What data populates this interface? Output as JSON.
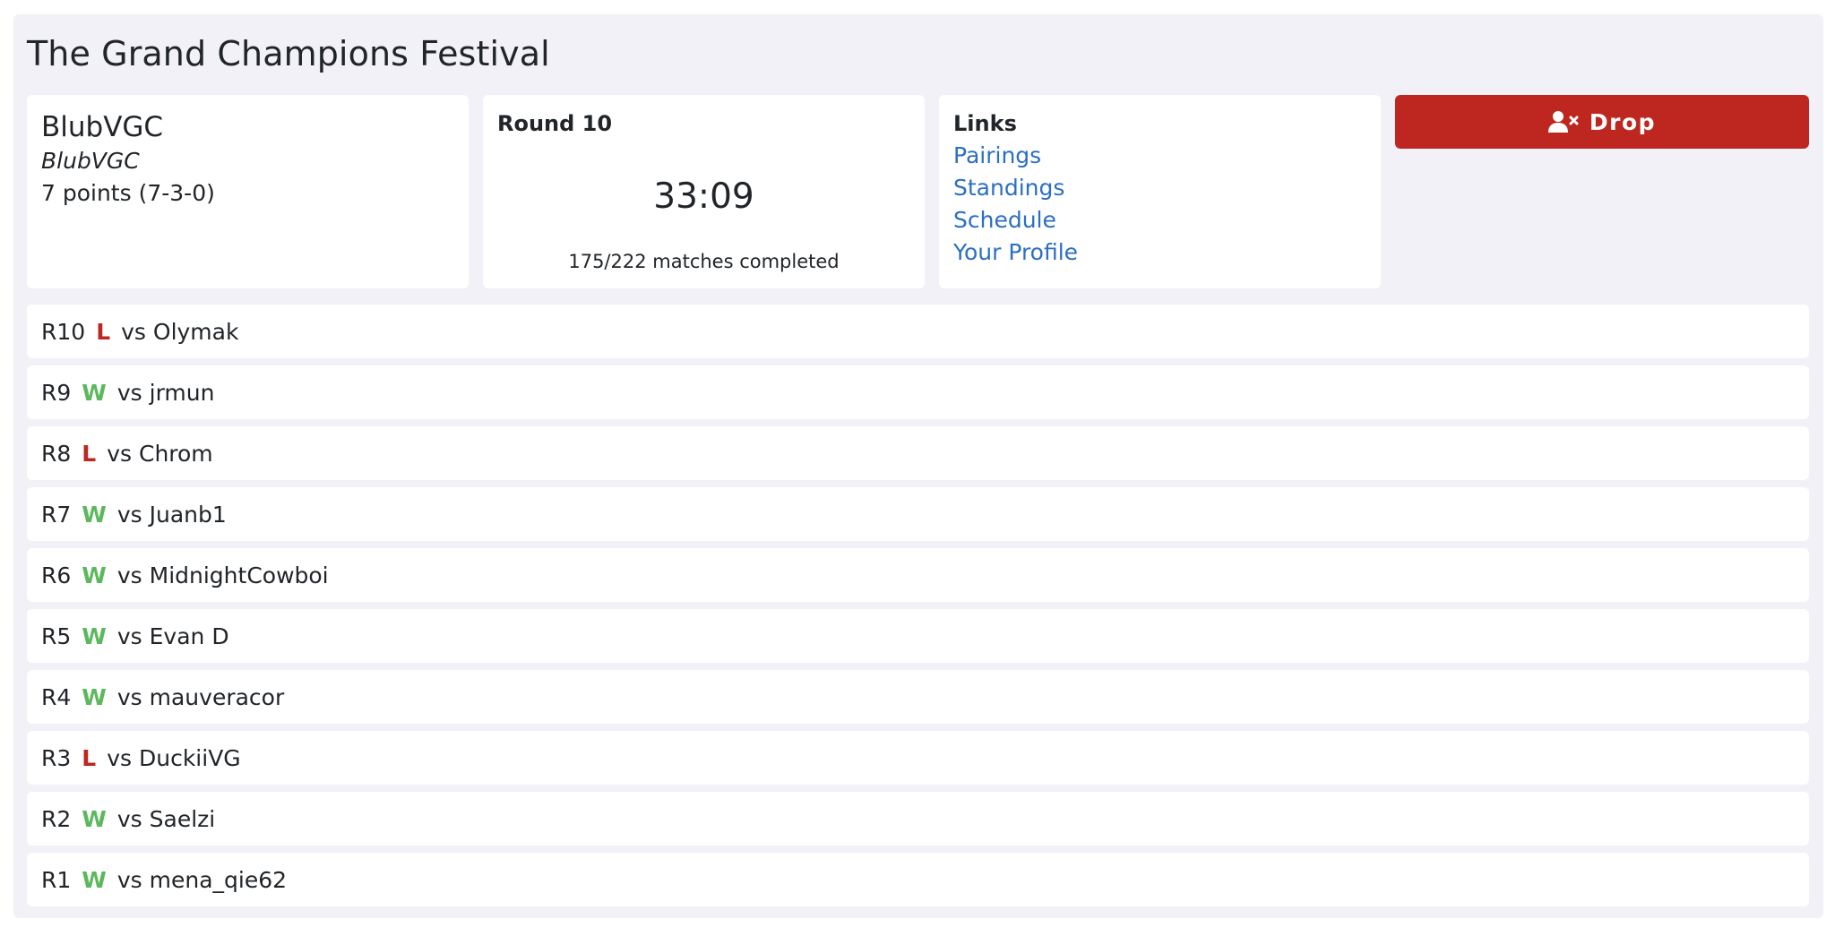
{
  "page": {
    "title": "The Grand Champions Festival"
  },
  "player": {
    "name": "BlubVGC",
    "team": "BlubVGC",
    "points": "7 points (7-3-0)"
  },
  "round": {
    "label": "Round 10",
    "timer": "33:09",
    "matches": "175/222 matches completed"
  },
  "links": {
    "label": "Links",
    "items": [
      "Pairings",
      "Standings",
      "Schedule",
      "Your Profile"
    ]
  },
  "drop_button": {
    "label": "Drop",
    "icon": "user-x-icon"
  },
  "colors": {
    "loss": "#bd2720",
    "win": "#5cb85c",
    "link": "#2b6fc4",
    "drop": "#bd2720",
    "panel": "#f1f1f7"
  },
  "history": [
    {
      "round": "R10",
      "result": "L",
      "opponent": "vs Olymak"
    },
    {
      "round": "R9",
      "result": "W",
      "opponent": "vs jrmun"
    },
    {
      "round": "R8",
      "result": "L",
      "opponent": "vs Chrom"
    },
    {
      "round": "R7",
      "result": "W",
      "opponent": "vs Juanb1"
    },
    {
      "round": "R6",
      "result": "W",
      "opponent": "vs MidnightCowboi"
    },
    {
      "round": "R5",
      "result": "W",
      "opponent": "vs Evan D"
    },
    {
      "round": "R4",
      "result": "W",
      "opponent": "vs mauveracor"
    },
    {
      "round": "R3",
      "result": "L",
      "opponent": "vs DuckiiVG"
    },
    {
      "round": "R2",
      "result": "W",
      "opponent": "vs Saelzi"
    },
    {
      "round": "R1",
      "result": "W",
      "opponent": "vs mena_qie62"
    }
  ]
}
